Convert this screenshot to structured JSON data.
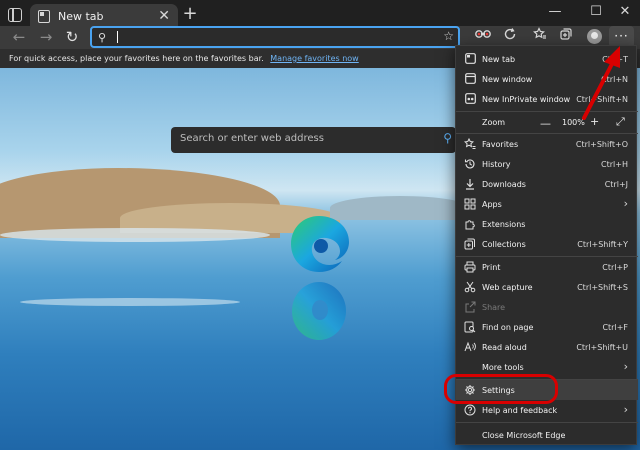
{
  "window": {
    "tab_label": "New tab",
    "tab_close": "✕",
    "new_tab": "+",
    "minimize": "—",
    "maximize": "☐",
    "close": "✕"
  },
  "toolbar": {
    "back": "←",
    "forward": "→",
    "refresh": "↻",
    "search_glyph": "⚲",
    "favorite_glyph": "☆",
    "more_label": "···"
  },
  "favorites_bar": {
    "text": "For quick access, place your favorites here on the favorites bar.",
    "link": "Manage favorites now"
  },
  "page": {
    "search_placeholder": "Search or enter web address"
  },
  "menu": {
    "new_tab": {
      "label": "New tab",
      "shortcut": "Ctrl+T"
    },
    "new_window": {
      "label": "New window",
      "shortcut": "Ctrl+N"
    },
    "new_inprivate": {
      "label": "New InPrivate window",
      "shortcut": "Ctrl+Shift+N"
    },
    "zoom": {
      "label": "Zoom",
      "minus": "—",
      "value": "100%",
      "plus": "+",
      "fullscreen": "⤢"
    },
    "favorites": {
      "label": "Favorites",
      "shortcut": "Ctrl+Shift+O"
    },
    "history": {
      "label": "History",
      "shortcut": "Ctrl+H"
    },
    "downloads": {
      "label": "Downloads",
      "shortcut": "Ctrl+J"
    },
    "apps": {
      "label": "Apps"
    },
    "extensions": {
      "label": "Extensions"
    },
    "collections": {
      "label": "Collections",
      "shortcut": "Ctrl+Shift+Y"
    },
    "print": {
      "label": "Print",
      "shortcut": "Ctrl+P"
    },
    "web_capture": {
      "label": "Web capture",
      "shortcut": "Ctrl+Shift+S"
    },
    "share": {
      "label": "Share"
    },
    "find_on_page": {
      "label": "Find on page",
      "shortcut": "Ctrl+F"
    },
    "read_aloud": {
      "label": "Read aloud",
      "shortcut": "Ctrl+Shift+U"
    },
    "more_tools": {
      "label": "More tools"
    },
    "settings": {
      "label": "Settings"
    },
    "help_feedback": {
      "label": "Help and feedback"
    },
    "close_edge": {
      "label": "Close Microsoft Edge"
    },
    "chevron": "›"
  },
  "icons": {
    "new_tab": "tab-icon",
    "new_window": "window-icon",
    "new_inprivate": "inprivate-icon",
    "favorites": "star-list-icon",
    "history": "history-icon",
    "downloads": "download-icon",
    "apps": "apps-icon",
    "extensions": "puzzle-icon",
    "collections": "collections-icon",
    "print": "print-icon",
    "web_capture": "scissors-icon",
    "share": "share-icon",
    "find_on_page": "find-icon",
    "read_aloud": "read-aloud-icon",
    "settings": "gear-icon",
    "help_feedback": "help-icon"
  },
  "colors": {
    "accent": "#4aa3f0",
    "annotation_red": "#d80000",
    "menu_bg": "#2c2c2c"
  }
}
